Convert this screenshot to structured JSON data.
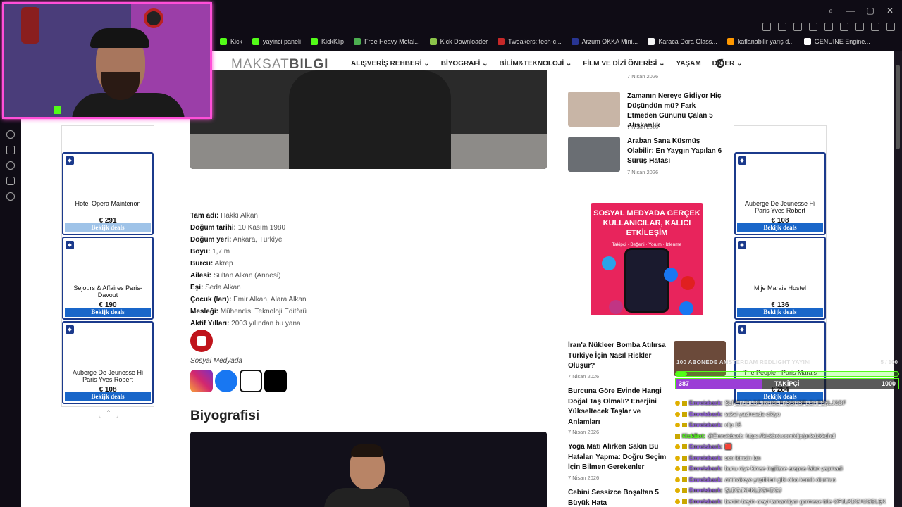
{
  "bookmarks": [
    {
      "label": "Kick",
      "color": "#53fc18"
    },
    {
      "label": "yayinci paneli",
      "color": "#53fc18"
    },
    {
      "label": "KickKlip",
      "color": "#53fc18"
    },
    {
      "label": "Free Heavy Metal...",
      "color": "#4caf50"
    },
    {
      "label": "Kick Downloader",
      "color": "#8bc34a"
    },
    {
      "label": "Tweakers: tech-c...",
      "color": "#c62828"
    },
    {
      "label": "Arzum OKKA Mini...",
      "color": "#283593"
    },
    {
      "label": "Karaca Dora Glass...",
      "color": "#f5f5f5"
    },
    {
      "label": "katlanabilir yarış d...",
      "color": "#ff9800"
    },
    {
      "label": "GENUINE Engine...",
      "color": "#ffffff"
    }
  ],
  "site": {
    "logo_a": "MAKSAT",
    "logo_b": "BILGI",
    "menu": [
      "ALIŞVERİŞ REHBERİ ⌄",
      "BİYOGRAFİ ⌄",
      "BİLİM&TEKNOLOJİ ⌄",
      "FİLM VE DİZİ ÖNERİSİ ⌄",
      "YAŞAM",
      "DİĞER ⌄"
    ]
  },
  "profile": [
    {
      "k": "Tam adı:",
      "v": " Hakkı Alkan"
    },
    {
      "k": "Doğum tarihi:",
      "v": " 10 Kasım 1980"
    },
    {
      "k": "Doğum yeri:",
      "v": " Ankara, Türkiye"
    },
    {
      "k": "Boyu:",
      "v": " 1,7 m"
    },
    {
      "k": "Burcu:",
      "v": " Akrep"
    },
    {
      "k": "Ailesi:",
      "v": " Sultan Alkan (Annesi)"
    },
    {
      "k": "Eşi:",
      "v": " Seda Alkan"
    },
    {
      "k": "Çocuk (ları):",
      "v": " Emir Alkan, Alara Alkan"
    },
    {
      "k": "Mesleği:",
      "v": " Mühendis, Teknoloji Editörü"
    },
    {
      "k": "Aktif Yılları:",
      "v": " 2003 yılından bu yana"
    }
  ],
  "social_label": "Sosyal Medyada",
  "bio_heading": "Biyografisi",
  "left_ads": [
    {
      "name": "Hotel Opera Maintenon",
      "price": "€ 291",
      "btn": "Bekijk deals"
    },
    {
      "name": "Sejours & Affaires Paris-Davout",
      "price": "€ 190",
      "btn": "Bekijk deals"
    },
    {
      "name": "Auberge De Jeunesse Hi Paris Yves Robert",
      "price": "€ 108",
      "btn": "Bekijk deals"
    }
  ],
  "right_ads": [
    {
      "name": "Auberge De Jeunesse Hi Paris Yves Robert",
      "price": "€ 108",
      "btn": "Bekijk deals"
    },
    {
      "name": "Mije Marais Hostel",
      "price": "€ 136",
      "btn": "Bekijk deals"
    },
    {
      "name": "The People - Paris Marais",
      "price": "€ 284",
      "btn": "Bekijk deals"
    }
  ],
  "top_posts": [
    {
      "date": "7 Nisan 2026"
    },
    {
      "title": "Zamanın Nereye Gidiyor Hiç Düşündün mü? Fark Etmeden Gününü Çalan 5 Alışkanlık",
      "date": "7 Nisan 2026"
    },
    {
      "title": "Araban Sana Küsmüş Olabilir: En Yaygın Yapılan 6 Sürüş Hatası",
      "date": "7 Nisan 2026"
    }
  ],
  "promo_text": "SOSYAL MEDYADA GERÇEK KULLANICILAR, KALICI ETKİLEŞİM",
  "promo_tags": "Takipçi · Beğeni · Yorum · İzlenme",
  "lower_posts": [
    {
      "title": "İran'a Nükleer Bomba Atılırsa Türkiye İçin Nasıl Riskler Oluşur?",
      "date": "7 Nisan 2026"
    },
    {
      "title": "Burcuna Göre Evinde Hangi Doğal Taş Olmalı? Enerjini Yükseltecek Taşlar ve Anlamları",
      "date": "7 Nisan 2026"
    },
    {
      "title": "Yoga Matı Alırken Sakın Bu Hataları Yapma: Doğru Seçim İçin Bilmen Gerekenler",
      "date": "7 Nisan 2026"
    },
    {
      "title": "Cebini Sessizce Boşaltan 5 Büyük Hata",
      "date": ""
    }
  ],
  "overlay": {
    "goal_title": "100 ABONEDE AMSTERDAM REDLIGHT YAYINI",
    "goal_count": "5 / 100",
    "goal_progress": 0.05,
    "followers": "387",
    "followers_label": "TAKİPÇİ",
    "followers_max": "1000",
    "followers_progress": 0.387,
    "chat": [
      {
        "user": "Emreisback:",
        "text": "ŞLFGKJHLDFJKHGLFKŞGHSFLGHFSKLJGDF",
        "badge": true
      },
      {
        "user": "Emreisback:",
        "text": "saksi yazincada cikiyo",
        "badge": true
      },
      {
        "user": "Emreisback:",
        "text": "clip 15",
        "badge": true
      },
      {
        "user": "KickBot:",
        "text": "@Emreisback: https://kickbot.com/clip/pnkdzkkdhdl",
        "badge": false,
        "bot": true
      },
      {
        "user": "Emreisback:",
        "text": "🟥",
        "badge": true
      },
      {
        "user": "Emreisback:",
        "text": "sen kimsin lan",
        "badge": true
      },
      {
        "user": "Emreisback:",
        "text": "bunu niye kimse ingilizce arapca falan yapmadi",
        "badge": true
      },
      {
        "user": "Emreisback:",
        "text": "aminakeye yaptiklari gibi olsa komik olurmus",
        "badge": true
      },
      {
        "user": "Emreisback:",
        "text": "ŞLDGJKHKLDGHDGJ",
        "badge": true
      },
      {
        "user": "Emreisback:",
        "text": "benim beyin orayi tamamliyor gormese bile OPJLKDGHJGDLŞK",
        "badge": true
      }
    ]
  }
}
